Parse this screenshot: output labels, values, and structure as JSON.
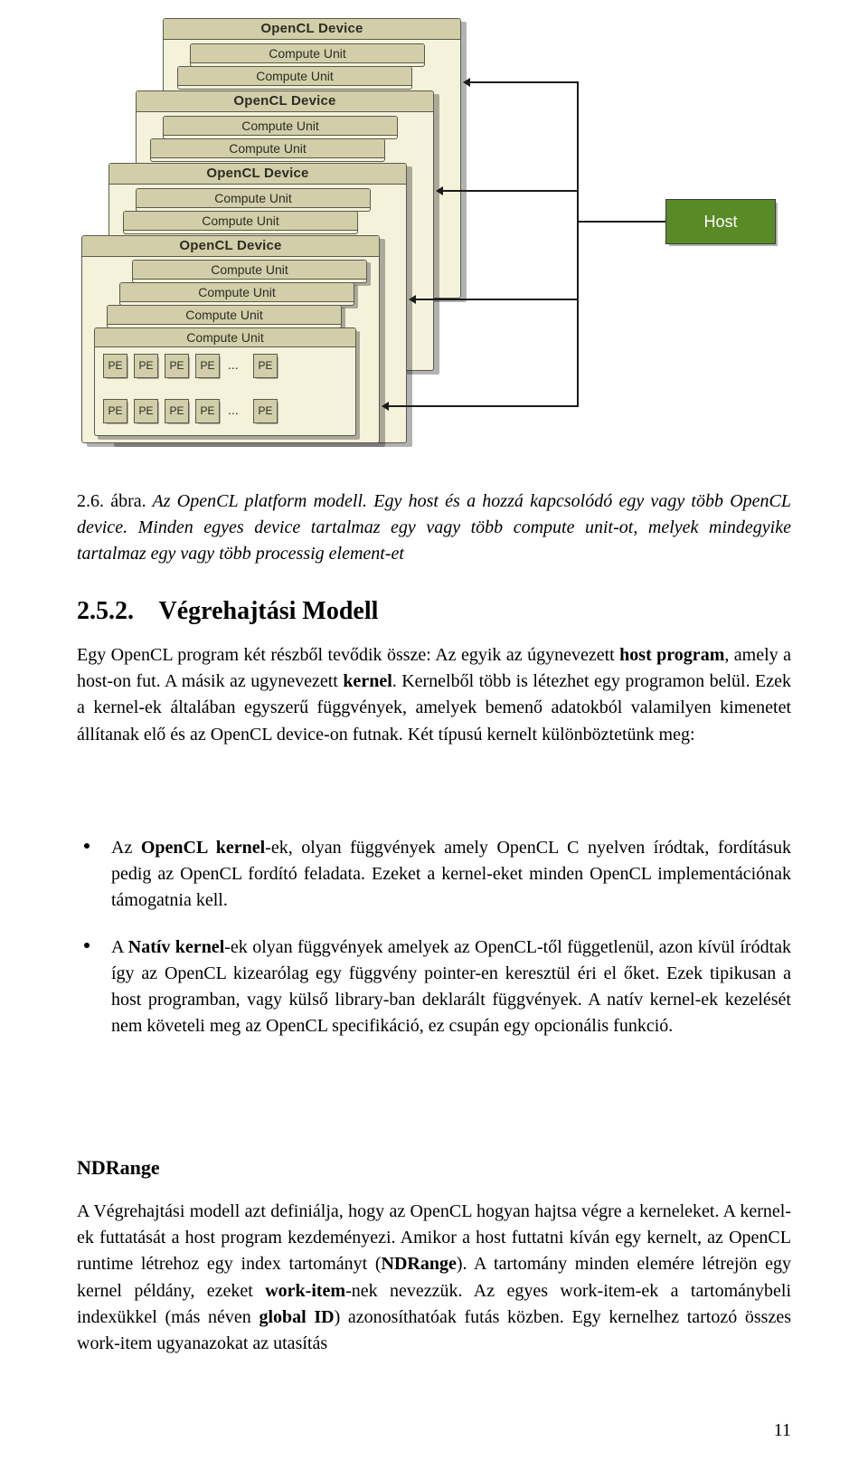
{
  "diagram": {
    "device_label": "OpenCL Device",
    "compute_unit_label": "Compute Unit",
    "host_label": "Host",
    "pe_label": "PE",
    "pe_ellipsis": "..."
  },
  "caption": {
    "lead_figure": "2.6. ábra.",
    "lead_title": "Az OpenCL platform modell.",
    "rest": "Egy host és a hozzá kapcsolódó egy vagy több OpenCL device. Minden egyes device tartalmaz egy vagy több compute unit-ot, melyek mindegyike tartalmaz egy vagy több processig element-et"
  },
  "heading": {
    "number": "2.5.2.",
    "text": "Végrehajtási Modell"
  },
  "para1": {
    "a": "Egy OpenCL program két részből tevődik össze: Az egyik az úgynevezett ",
    "b_hostprogram": "host program",
    "c": ", amely a host-on fut. A másik az ugynevezett ",
    "b_kernel": "kernel",
    "d": ". Kernelből több is létezhet egy programon belül. Ezek a kernel-ek általában egyszerű függvények, amelyek bemenő adatokból valamilyen kimenetet állítanak elő és az OpenCL device-on futnak. Két típusú kernelt különböztetünk meg:"
  },
  "bullets": {
    "item1": {
      "a": "Az ",
      "b": "OpenCL kernel",
      "c": "-ek, olyan függvények amely OpenCL C nyelven íródtak, fordításuk pedig az OpenCL fordító feladata. Ezeket a kernel-eket minden OpenCL implementációnak támogatnia kell."
    },
    "item2": {
      "a": "A ",
      "b": "Natív kernel",
      "c": "-ek olyan függvények amelyek az OpenCL-től függetlenül, azon kívül íródtak így az OpenCL kizearólag egy függvény pointer-en keresztül éri el őket. Ezek tipikusan a host programban, vagy külső library-ban deklarált függvények. A natív kernel-ek kezelését nem követeli meg az OpenCL specifikáció, ez csupán egy opcionális funkció."
    }
  },
  "subhead": "NDRange",
  "para2": {
    "a": "A Végrehajtási modell azt definiálja, hogy az OpenCL hogyan hajtsa végre a kerneleket. A kernel-ek futtatását a host program kezdeményezi. Amikor a host futtatni kíván egy kernelt, az OpenCL runtime létrehoz egy index tartományt (",
    "b_ndrange": "NDRange",
    "c": "). A tartomány minden elemére létrejön egy kernel példány, ezeket ",
    "b_workitem": "work-item",
    "d": "-nek nevezzük. Az egyes work-item-ek a tartománybeli indexükkel (más néven ",
    "b_globalid": "global ID",
    "e": ") azonosíthatóak futás közben. Egy kernelhez tartozó összes work-item ugyanazokat az utasítás"
  },
  "pagenum": "11"
}
